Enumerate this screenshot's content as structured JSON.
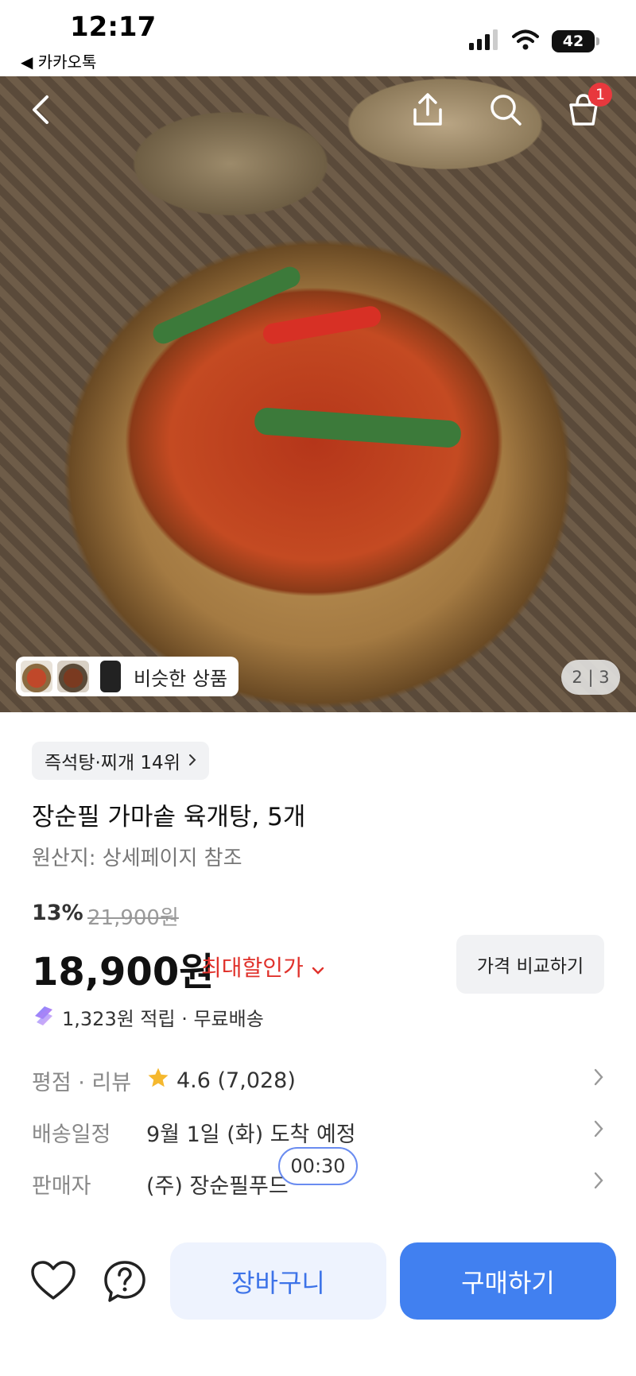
{
  "status_bar": {
    "time": "12:17",
    "back_app": "◀ 카카오톡",
    "battery": "42"
  },
  "header": {
    "cart_badge": "1"
  },
  "gallery": {
    "similar_label": "비슷한 상품",
    "page_indicator": "2 | 3"
  },
  "product": {
    "rank_chip": "즉석탕·찌개 14위",
    "title": "장순필 가마솥 육개탕, 5개",
    "origin": "원산지: 상세페이지 참조",
    "discount_rate": "13%",
    "original_price": "21,900원",
    "price": "18,900원",
    "max_discount_label": "최대할인가",
    "compare_button": "가격 비교하기",
    "points_text": "1,323원 적립 · 무료배송"
  },
  "details": {
    "rating_label": "평점 · 리뷰",
    "rating_value": "4.6 (7,028)",
    "delivery_label": "배송일정",
    "delivery_value": "9월 1일 (화) 도착 예정",
    "seller_label": "판매자",
    "seller_value": "(주) 장순필푸드"
  },
  "timer": "00:30",
  "bottom_bar": {
    "cart_label": "장바구니",
    "buy_label": "구매하기"
  },
  "colors": {
    "primary_blue": "#4180f0",
    "discount_red": "#e0322c",
    "badge_red": "#e8383d",
    "star_yellow": "#f5b82e"
  }
}
